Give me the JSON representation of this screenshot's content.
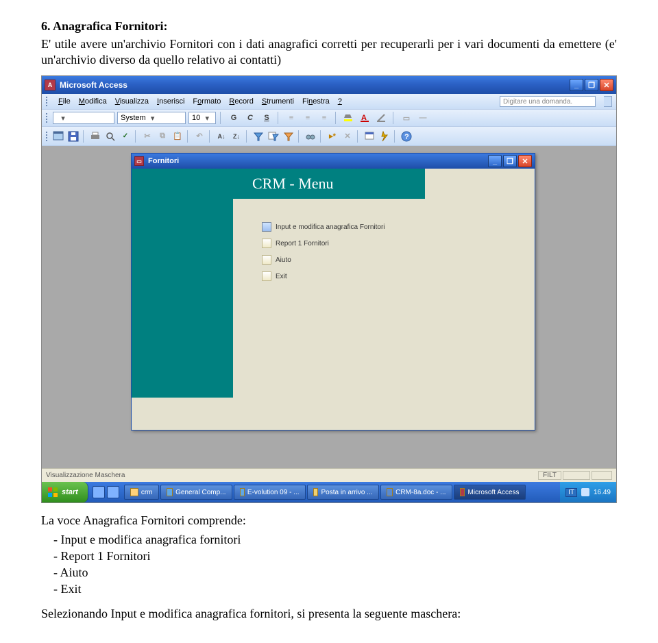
{
  "doc": {
    "title": "6.  Anagrafica Fornitori:",
    "para1": "E' utile avere un'archivio Fornitori con i dati anagrafici corretti per recuperarli per i vari documenti da emettere (e' un'archivio diverso da quello relativo ai contatti)",
    "list_intro": "La voce Anagrafica Fornitori comprende:",
    "list": {
      "l0": "Input e modifica anagrafica fornitori",
      "l1": "Report 1 Fornitori",
      "l2": "Aiuto",
      "l3": "Exit"
    },
    "para2": "Selezionando Input e modifica anagrafica fornitori, si presenta la seguente maschera:"
  },
  "app": {
    "title": "Microsoft Access",
    "help_placeholder": "Digitare una domanda.",
    "menus": {
      "m0": "File",
      "m1": "Modifica",
      "m2": "Visualizza",
      "m3": "Inserisci",
      "m4": "Formato",
      "m5": "Record",
      "m6": "Strumenti",
      "m7": "Finestra",
      "m8": "?"
    },
    "font_name": "System",
    "font_size": "10",
    "bold": "G",
    "italic": "C",
    "under": "S",
    "status_left": "Visualizzazione Maschera",
    "status_filt": "FILT"
  },
  "inner": {
    "title": "Fornitori",
    "crm": "CRM - Menu",
    "items": {
      "i0": "Input e modifica anagrafica Fornitori",
      "i1": "Report 1 Fornitori",
      "i2": "Aiuto",
      "i3": "Exit"
    }
  },
  "taskbar": {
    "start": "start",
    "t0": "crm",
    "t1": "General Comp...",
    "t2": "E-volution 09 - ...",
    "t3": "Posta in arrivo ...",
    "t4": "CRM-8a.doc - ...",
    "t5": "Microsoft Access",
    "lang": "IT",
    "time": "16.49"
  }
}
